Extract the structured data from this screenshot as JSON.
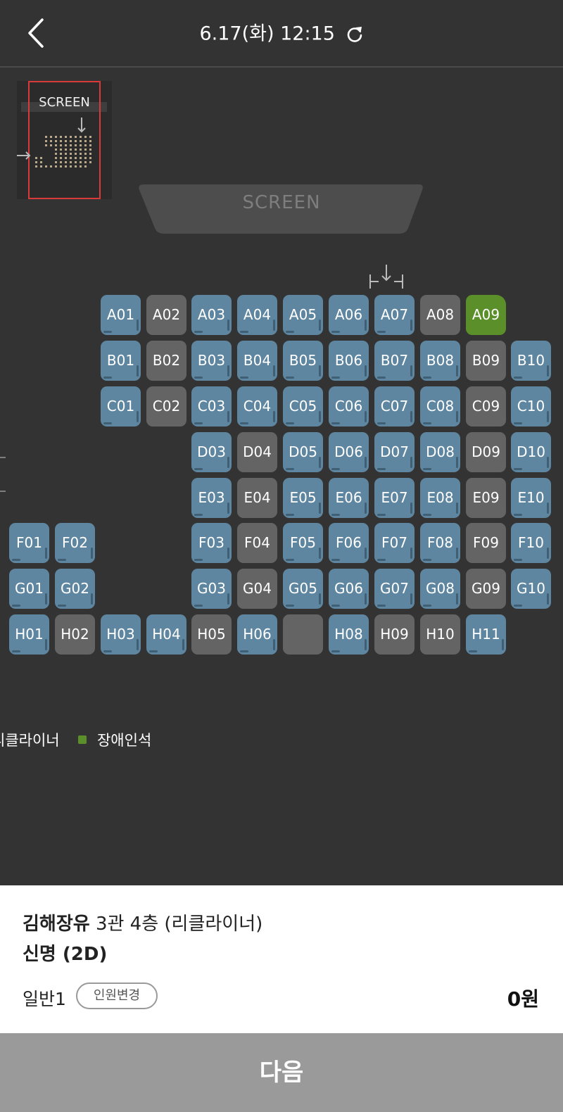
{
  "header": {
    "showtime": "6.17(화) 12:15"
  },
  "minimap": {
    "screen_label": "SCREEN"
  },
  "screen_label": "SCREEN",
  "seat_colors": {
    "available": "#5f86a0",
    "taken": "#646464",
    "accessible": "#5a8f2a"
  },
  "rows": [
    {
      "row": "A",
      "seats": [
        {
          "id": "A01",
          "state": "available"
        },
        {
          "id": "A02",
          "state": "taken"
        },
        {
          "id": "A03",
          "state": "available"
        },
        {
          "id": "A04",
          "state": "available"
        },
        {
          "id": "A05",
          "state": "available"
        },
        {
          "id": "A06",
          "state": "available"
        },
        {
          "id": "A07",
          "state": "available"
        },
        {
          "id": "A08",
          "state": "taken"
        },
        {
          "id": "A09",
          "state": "accessible"
        }
      ]
    },
    {
      "row": "B",
      "seats": [
        {
          "id": "B01",
          "state": "available"
        },
        {
          "id": "B02",
          "state": "taken"
        },
        {
          "id": "B03",
          "state": "available"
        },
        {
          "id": "B04",
          "state": "available"
        },
        {
          "id": "B05",
          "state": "available"
        },
        {
          "id": "B06",
          "state": "available"
        },
        {
          "id": "B07",
          "state": "available"
        },
        {
          "id": "B08",
          "state": "available"
        },
        {
          "id": "B09",
          "state": "taken"
        },
        {
          "id": "B10",
          "state": "available"
        }
      ]
    },
    {
      "row": "C",
      "seats": [
        {
          "id": "C01",
          "state": "available"
        },
        {
          "id": "C02",
          "state": "taken"
        },
        {
          "id": "C03",
          "state": "available"
        },
        {
          "id": "C04",
          "state": "available"
        },
        {
          "id": "C05",
          "state": "available"
        },
        {
          "id": "C06",
          "state": "available"
        },
        {
          "id": "C07",
          "state": "available"
        },
        {
          "id": "C08",
          "state": "available"
        },
        {
          "id": "C09",
          "state": "taken"
        },
        {
          "id": "C10",
          "state": "available"
        }
      ]
    },
    {
      "row": "D",
      "seats": [
        {
          "id": "D03",
          "state": "available"
        },
        {
          "id": "D04",
          "state": "taken"
        },
        {
          "id": "D05",
          "state": "available"
        },
        {
          "id": "D06",
          "state": "available"
        },
        {
          "id": "D07",
          "state": "available"
        },
        {
          "id": "D08",
          "state": "available"
        },
        {
          "id": "D09",
          "state": "taken"
        },
        {
          "id": "D10",
          "state": "available"
        }
      ]
    },
    {
      "row": "E",
      "seats": [
        {
          "id": "E03",
          "state": "available"
        },
        {
          "id": "E04",
          "state": "taken"
        },
        {
          "id": "E05",
          "state": "available"
        },
        {
          "id": "E06",
          "state": "available"
        },
        {
          "id": "E07",
          "state": "available"
        },
        {
          "id": "E08",
          "state": "available"
        },
        {
          "id": "E09",
          "state": "taken"
        },
        {
          "id": "E10",
          "state": "available"
        }
      ]
    },
    {
      "row": "F",
      "seats": [
        {
          "id": "F01",
          "state": "available"
        },
        {
          "id": "F02",
          "state": "available"
        },
        {
          "id": "F03",
          "state": "available"
        },
        {
          "id": "F04",
          "state": "taken"
        },
        {
          "id": "F05",
          "state": "available"
        },
        {
          "id": "F06",
          "state": "available"
        },
        {
          "id": "F07",
          "state": "available"
        },
        {
          "id": "F08",
          "state": "available"
        },
        {
          "id": "F09",
          "state": "taken"
        },
        {
          "id": "F10",
          "state": "available"
        }
      ]
    },
    {
      "row": "G",
      "seats": [
        {
          "id": "G01",
          "state": "available"
        },
        {
          "id": "G02",
          "state": "available"
        },
        {
          "id": "G03",
          "state": "available"
        },
        {
          "id": "G04",
          "state": "taken"
        },
        {
          "id": "G05",
          "state": "available"
        },
        {
          "id": "G06",
          "state": "available"
        },
        {
          "id": "G07",
          "state": "available"
        },
        {
          "id": "G08",
          "state": "available"
        },
        {
          "id": "G09",
          "state": "taken"
        },
        {
          "id": "G10",
          "state": "available"
        }
      ]
    },
    {
      "row": "H",
      "seats": [
        {
          "id": "H01",
          "state": "available"
        },
        {
          "id": "H02",
          "state": "taken"
        },
        {
          "id": "H03",
          "state": "available"
        },
        {
          "id": "H04",
          "state": "available"
        },
        {
          "id": "H05",
          "state": "taken"
        },
        {
          "id": "H06",
          "state": "available"
        },
        {
          "id": "",
          "state": "taken"
        },
        {
          "id": "H08",
          "state": "available"
        },
        {
          "id": "H09",
          "state": "taken"
        },
        {
          "id": "H10",
          "state": "taken"
        },
        {
          "id": "H11",
          "state": "available"
        }
      ]
    }
  ],
  "legend": {
    "recliner_label": "리클라이너",
    "accessible_label": "장애인석"
  },
  "booking": {
    "theater_name": "김해장유",
    "hall": "3관 4층 (리클라이너)",
    "movie": "신명 (2D)",
    "audience": "일반1",
    "change_button": "인원변경",
    "price": "0원"
  },
  "next_button": "다음"
}
